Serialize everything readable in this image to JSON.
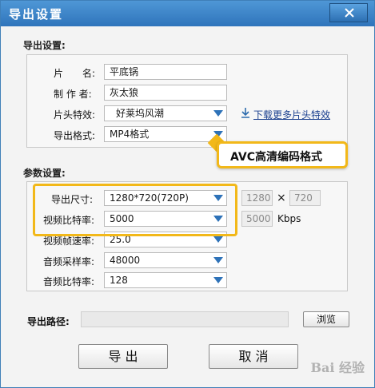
{
  "window": {
    "title": "导出设置"
  },
  "export_settings": {
    "section_title": "导出设置:",
    "name_label": "片　　名:",
    "name_value": "平底锅",
    "author_label": "制 作 者:",
    "author_value": "灰太狼",
    "opening_label": "片头特效:",
    "opening_value": "好莱坞风潮",
    "download_link": "下载更多片头特效",
    "format_label": "导出格式:",
    "format_value": "MP4格式"
  },
  "callout": {
    "text": "AVC高清编码格式"
  },
  "params": {
    "section_title": "参数设置:",
    "size_label": "导出尺寸:",
    "size_value": "1280*720(720P)",
    "width": "1280",
    "x_sign": "×",
    "height": "720",
    "video_bitrate_label": "视频比特率:",
    "video_bitrate_value": "5000",
    "video_bitrate_readout": "5000",
    "kbps": "Kbps",
    "framerate_label": "视频帧速率:",
    "framerate_value": "25.0",
    "samplerate_label": "音频采样率:",
    "samplerate_value": "48000",
    "audio_bitrate_label": "音频比特率:",
    "audio_bitrate_value": "128"
  },
  "path": {
    "label": "导出路径:",
    "value": "",
    "browse": "浏览"
  },
  "buttons": {
    "export": "导 出",
    "cancel": "取 消"
  },
  "watermark": "Bai 经验"
}
